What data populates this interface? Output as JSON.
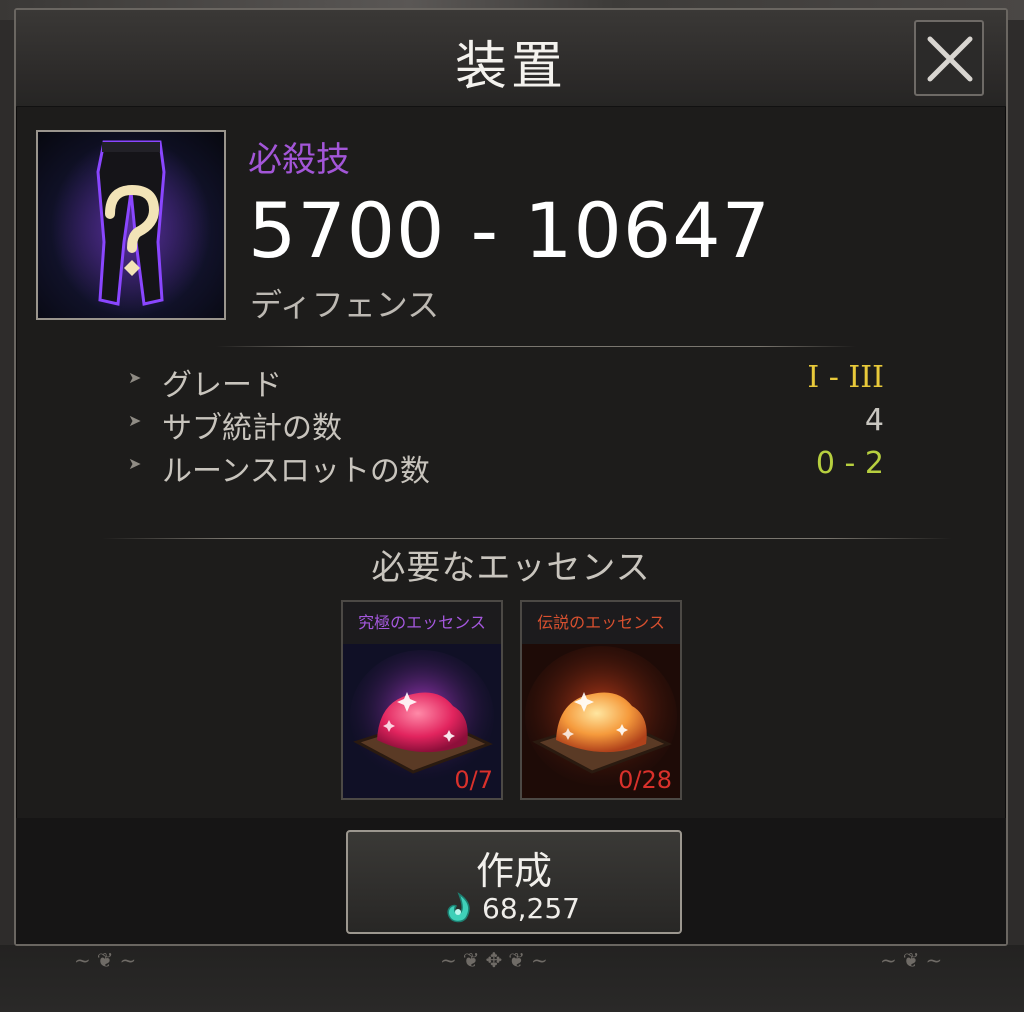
{
  "dialog": {
    "title": "装置"
  },
  "item": {
    "skill_label": "必殺技",
    "value_range": "5700 - 10647",
    "stat_type": "ディフェンス"
  },
  "stats": [
    {
      "label": "グレード",
      "value": "I - III",
      "color": "#e8c93a"
    },
    {
      "label": "サブ統計の数",
      "value": "4",
      "color": "#c9c6c0"
    },
    {
      "label": "ルーンスロットの数",
      "value": "0 - 2",
      "color": "#b7cf3f"
    }
  ],
  "required": {
    "title": "必要なエッセンス",
    "essences": [
      {
        "name": "究極のエッセンス",
        "count": "0/7",
        "name_color": "#a558de",
        "icon": "ultimate-essence-icon"
      },
      {
        "name": "伝説のエッセンス",
        "count": "0/28",
        "name_color": "#d8502f",
        "icon": "legendary-essence-icon"
      }
    ]
  },
  "create": {
    "label": "作成",
    "cost": "68,257",
    "cost_icon": "soul-currency-icon"
  },
  "colors": {
    "skill": "#a356d8",
    "count_red": "#d9312b"
  }
}
